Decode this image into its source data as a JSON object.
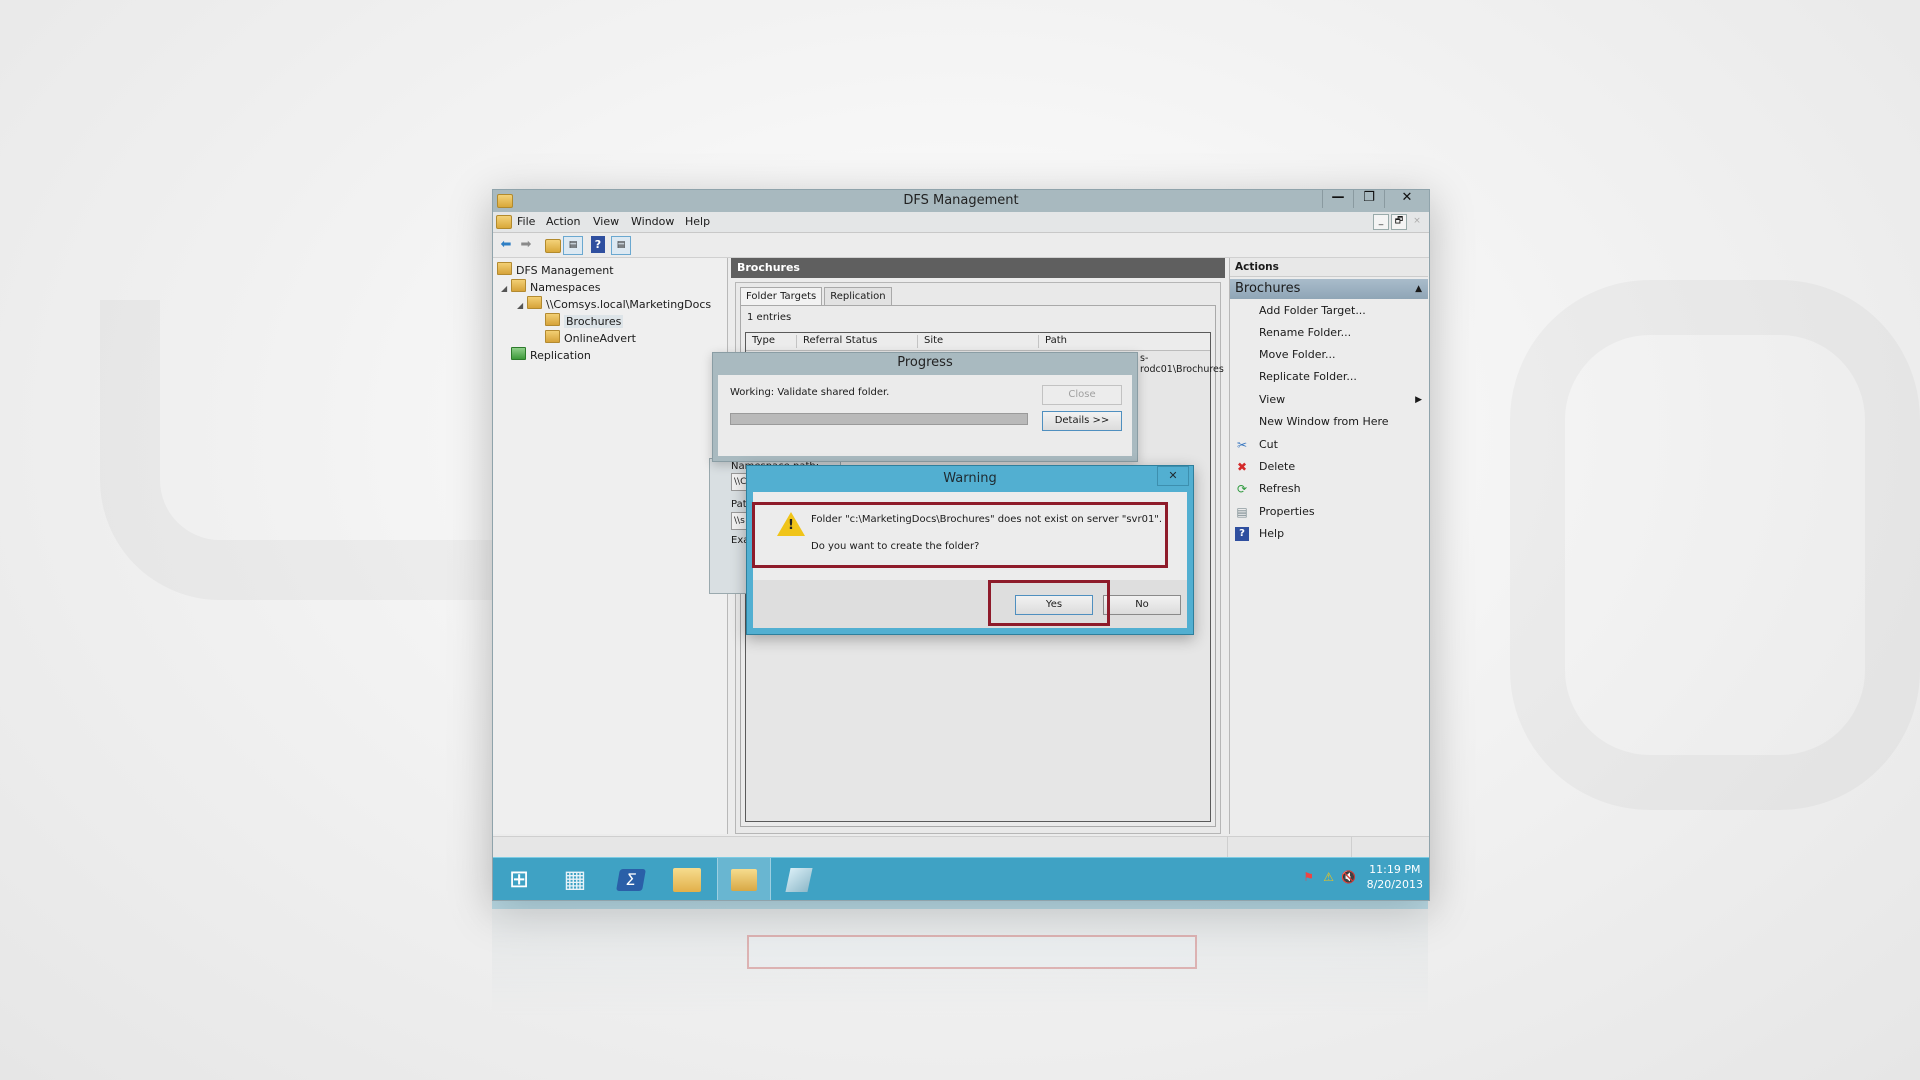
{
  "window": {
    "title": "DFS Management",
    "controls": {
      "minimize": "—",
      "restore": "❐",
      "close": "✕"
    },
    "mdi_controls": {
      "minimize": "_",
      "restore": "🗗",
      "close": "×"
    }
  },
  "menu": [
    "File",
    "Action",
    "View",
    "Window",
    "Help"
  ],
  "toolbar": {
    "back": "back-arrow",
    "forward": "forward-arrow",
    "up": "up-folder",
    "show_hide_tree": "console-tree",
    "help": "help",
    "show_hide_actions": "action-pane"
  },
  "tree": {
    "root": "DFS Management",
    "namespaces": "Namespaces",
    "namespace_path": "\\\\Comsys.local\\MarketingDocs",
    "folders": [
      "Brochures",
      "OnlineAdvert"
    ],
    "replication": "Replication",
    "selected": "Brochures"
  },
  "center": {
    "title": "Brochures",
    "tabs": [
      "Folder Targets",
      "Replication"
    ],
    "active_tab": "Folder Targets",
    "entries": "1 entries",
    "columns": [
      "Type",
      "Referral Status",
      "Site",
      "Path"
    ],
    "rows": [
      {
        "path_partial": "s-rodc01\\Brochures"
      }
    ]
  },
  "actions": {
    "header": "Actions",
    "section": "Brochures",
    "items": [
      {
        "label": "Add Folder Target...",
        "icon": ""
      },
      {
        "label": "Rename Folder...",
        "icon": ""
      },
      {
        "label": "Move Folder...",
        "icon": ""
      },
      {
        "label": "Replicate Folder...",
        "icon": ""
      },
      {
        "label": "View",
        "icon": "",
        "submenu": "▶"
      },
      {
        "label": "New Window from Here",
        "icon": ""
      },
      {
        "label": "Cut",
        "icon": "✂"
      },
      {
        "label": "Delete",
        "icon": "✖"
      },
      {
        "label": "Refresh",
        "icon": "⟳"
      },
      {
        "label": "Properties",
        "icon": "▤"
      },
      {
        "label": "Help",
        "icon": "?"
      }
    ]
  },
  "progress_dialog": {
    "title": "Progress",
    "message": "Working: Validate shared folder.",
    "close_label": "Close",
    "details_label": "Details >>",
    "progress_percent": 100
  },
  "behind_dialog": {
    "namespace_path_label": "Namespace path:",
    "namespace_path_value": "\\\\C",
    "path_label": "Path",
    "path_value": "\\\\s",
    "example_label": "Exa"
  },
  "warning_dialog": {
    "title": "Warning",
    "close": "✕",
    "message": "Folder \"c:\\MarketingDocs\\Brochures\" does not exist on server \"svr01\".",
    "question": "Do you want to create the folder?",
    "yes_label": "Yes",
    "no_label": "No",
    "highlight_color": "#8e1b2a"
  },
  "taskbar": {
    "apps": [
      "Start",
      "Server Manager",
      "Windows PowerShell",
      "File Explorer",
      "DFS Management",
      "Notepad"
    ],
    "active_app": "DFS Management",
    "clock_time": "11:19 PM",
    "clock_date": "8/20/2013",
    "tray_icons": [
      "action-center-flag",
      "network-warning",
      "volume-muted"
    ],
    "accent": "#3fa2c4"
  }
}
